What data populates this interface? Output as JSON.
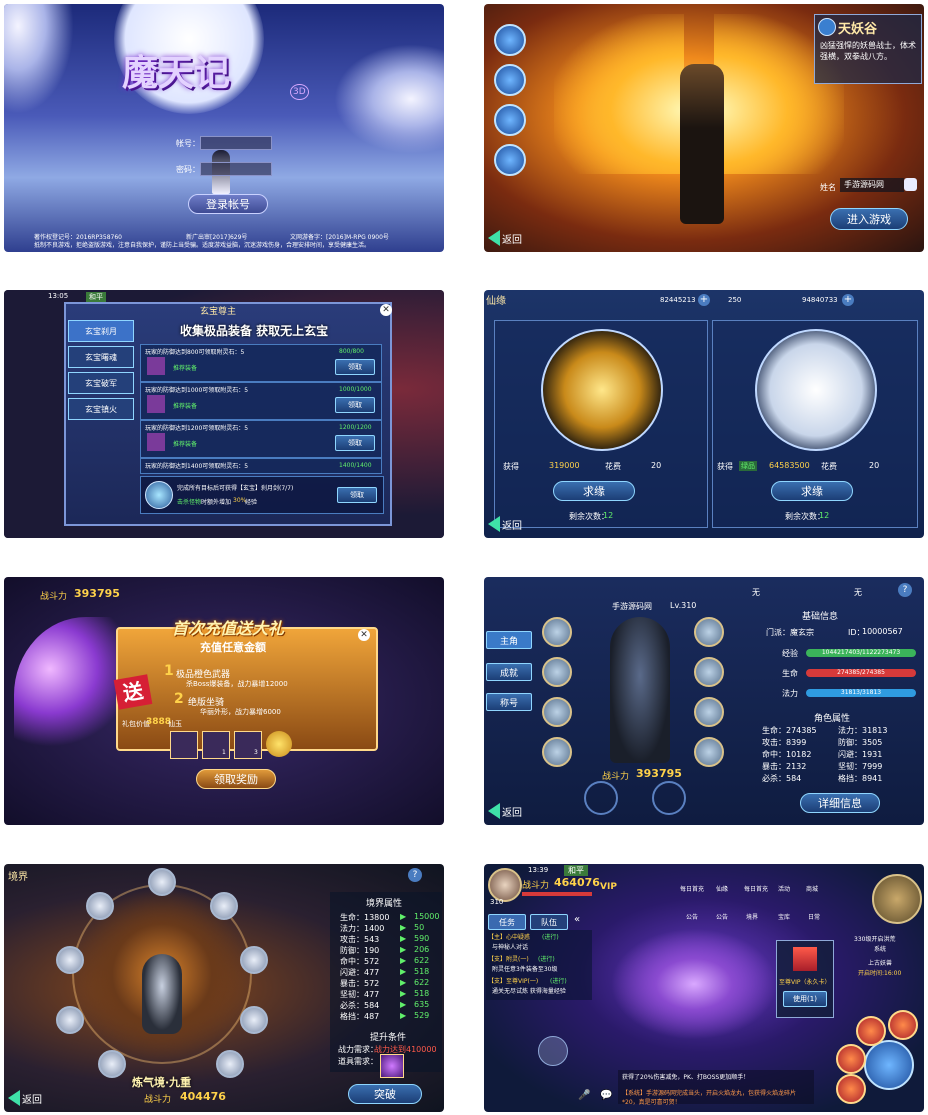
{
  "s1": {
    "logo": "魔天记",
    "logo_sub": "3D",
    "account_label": "帐号：",
    "password_label": "密码：",
    "login_button": "登录帐号",
    "footer_left": "著作权登记号：2016RP358760",
    "footer_mid": "新广出审[2017]629号",
    "footer_right": "文网游备字：[2016]M-RPG 0900号",
    "footer_line2": "抵制不良游戏，拒绝盗版游戏，注意自我保护，谨防上当受骗。适度游戏益脑，沉迷游戏伤身，合理安排时间，享受健康生活。"
  },
  "s2": {
    "race_title": "天妖谷",
    "race_desc": "凶猛强悍的妖兽战士，体术强横，双拳战八方。",
    "name_label": "姓名",
    "name_value": "手游源码网",
    "enter_button": "进入游戏",
    "back": "返回"
  },
  "s3": {
    "time": "13:05",
    "peace": "和平",
    "title": "玄宝尊主",
    "banner": "收集极品装备 获取无上玄宝",
    "tabs": [
      "玄宝刹月",
      "玄宝曙魂",
      "玄宝破军",
      "玄宝镇火"
    ],
    "tasks": [
      {
        "desc": "玩家的防御达到800可领取附灵石：5",
        "progress": "800/800",
        "tag": "推荐装备",
        "button": "领取"
      },
      {
        "desc": "玩家的防御达到1000可领取附灵石：5",
        "progress": "1000/1000",
        "tag": "推荐装备",
        "button": "领取"
      },
      {
        "desc": "玩家的防御达到1200可领取附灵石：5",
        "progress": "1200/1200",
        "tag": "推荐装备",
        "button": "领取"
      },
      {
        "desc": "玩家的防御达到1400可领取附灵石：5",
        "progress": "1400/1400",
        "tag": "",
        "button": ""
      }
    ],
    "final_desc": "完成所有目标后可获得【玄宝】刹月剑(7/7)",
    "final_bonus_pre": "击杀怪物",
    "final_bonus_mid": "时额外增加",
    "final_bonus_pct": "30%",
    "final_bonus_post": "经验",
    "final_button": "领取"
  },
  "s4": {
    "title": "仙缘",
    "currency": [
      "82445213",
      "250",
      "94840733"
    ],
    "left": {
      "get_label": "获得",
      "get_value": "319000",
      "cost_label": "花费",
      "cost_value": "20",
      "button": "求缘",
      "remain_label": "剩余次数：",
      "remain_value": "12"
    },
    "right": {
      "get_label": "获得",
      "get_tag": "绿品",
      "get_value": "64583500",
      "cost_label": "花费",
      "cost_value": "20",
      "button": "求缘",
      "remain_label": "剩余次数：",
      "remain_value": "12"
    },
    "back": "返回"
  },
  "s5": {
    "power_label": "战斗力",
    "power_value": "393795",
    "title": "首次充值送大礼",
    "subtitle": "充值任意金额",
    "gift_tag": "送",
    "item1_num": "1",
    "item1_title": "极品橙色武器",
    "item1_desc": "杀Boss爆装备，战力暴增12000",
    "item2_num": "2",
    "item2_title": "绝版坐骑",
    "item2_desc": "华丽外形，战力暴增6000",
    "gift_value_label": "礼包价值",
    "gift_value": "3888",
    "gift_value_unit": "仙玉",
    "slot_counts": [
      "1",
      "3"
    ],
    "claim_button": "领取奖励"
  },
  "s6": {
    "tabs": [
      "主角",
      "成就",
      "称号"
    ],
    "name": "手游源码网",
    "level": "Lv.310",
    "wu": [
      "无",
      "无"
    ],
    "info_title": "基础信息",
    "sect_label": "门派：",
    "sect_value": "魔玄宗",
    "id_label": "ID：",
    "id_value": "10000567",
    "bars": [
      {
        "label": "经验",
        "value": "1044217403/1122273473",
        "color": "#3bb45a"
      },
      {
        "label": "生命",
        "value": "274385/274385",
        "color": "#d63a3a"
      },
      {
        "label": "法力",
        "value": "31813/31813",
        "color": "#2f9be0"
      }
    ],
    "attr_title": "角色属性",
    "attrs": [
      [
        "生命：274385",
        "法力：31813"
      ],
      [
        "攻击：8399",
        "防御：3505"
      ],
      [
        "命中：10182",
        "闪避：1931"
      ],
      [
        "暴击：2132",
        "坚韧：7999"
      ],
      [
        "必杀：584",
        "格挡：8941"
      ]
    ],
    "power_label": "战斗力",
    "power_value": "393795",
    "detail_button": "详细信息",
    "back": "返回"
  },
  "s7": {
    "title": "境界",
    "attr_title": "境界属性",
    "attrs": [
      [
        "生命：13800",
        "15000"
      ],
      [
        "法力：1400",
        "50"
      ],
      [
        "攻击：543",
        "590"
      ],
      [
        "防御：190",
        "206"
      ],
      [
        "命中：572",
        "622"
      ],
      [
        "闪避：477",
        "518"
      ],
      [
        "暴击：572",
        "622"
      ],
      [
        "坚韧：477",
        "518"
      ],
      [
        "必杀：584",
        "635"
      ],
      [
        "格挡：487",
        "529"
      ]
    ],
    "cond_title": "提升条件",
    "cond_power_label": "战力需求：",
    "cond_power_value": "战力达到410000",
    "cond_item_label": "道具需求：",
    "realm_name": "炼气境·九重",
    "power_label": "战斗力",
    "power_value": "404476",
    "breakthrough_button": "突破",
    "back": "返回"
  },
  "s8": {
    "time": "13:39",
    "peace": "和平",
    "power_label": "战斗力",
    "power_value": "464076",
    "level": "310",
    "vip": "VIP",
    "menu_row1": [
      "每日首充",
      "仙缘",
      "每日首充",
      "活动",
      "商城"
    ],
    "menu_row2": [
      "公告",
      "公告",
      "境界",
      "宝库",
      "日常"
    ],
    "task_tab": "任务",
    "team_tab": "队伍",
    "quests": [
      {
        "name": "【主】心中疑惑",
        "state": "(进行)",
        "desc": "与神秘人对话"
      },
      {
        "name": "【支】附灵(一)",
        "state": "(进行)",
        "desc": "附灵任意3件装备至30级"
      },
      {
        "name": "【支】至尊VIP(一)",
        "state": "(进行)",
        "desc": "通关无尽试炼 获得海量经验"
      }
    ],
    "vip_card": "至尊VIP（永久卡）",
    "use_button": "使用(1)",
    "event_text": "330级开启洪荒",
    "event_text2": "系统",
    "event2": "上古妖兽",
    "event2_time": "开启时间:16:00",
    "chat1": "获得了20%伤害减免，PK、打BOSS更加顺手！",
    "chat2": "【系统】手游源码网完成当头，开启火焰龙丸，包获得火焰龙碎片*20，真是可喜可贺！"
  }
}
